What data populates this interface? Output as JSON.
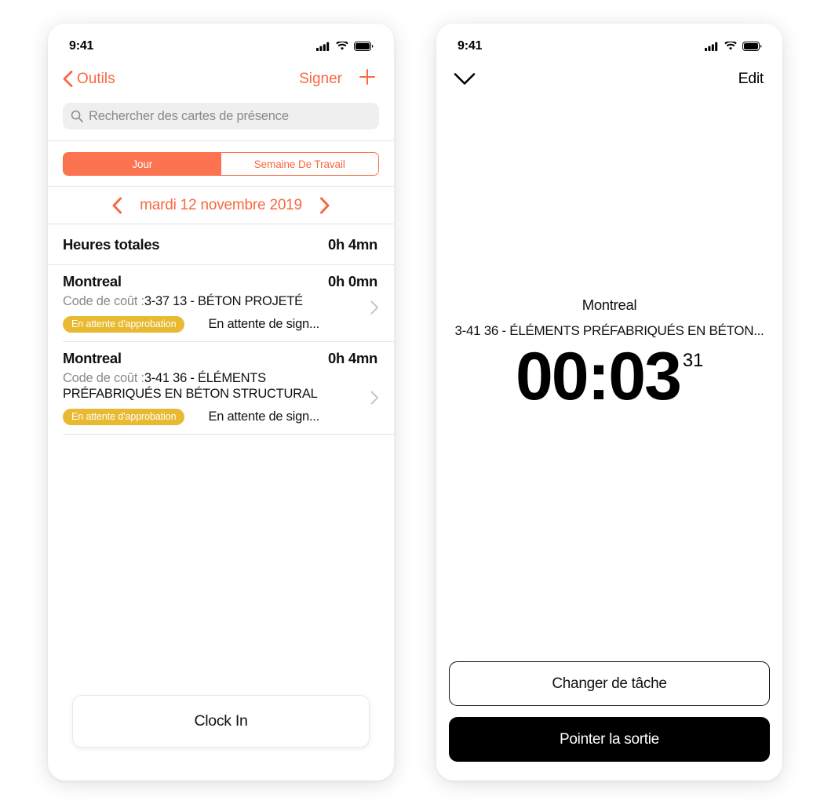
{
  "colors": {
    "accent_orange": "#FB7350",
    "accent_orange_text": "#F9683F",
    "badge_amber": "#E8B931",
    "primary_black": "#000000",
    "search_background": "#EFEFF0",
    "muted_text": "#8A8A8E",
    "hairline": "#E4E4E6"
  },
  "left_phone": {
    "status_bar": {
      "time": "9:41",
      "icons": [
        "cellular-signal-icon",
        "wifi-icon",
        "battery-icon"
      ]
    },
    "navbar": {
      "back_icon": "chevron-left-icon",
      "back_label": "Outils",
      "sign_label": "Signer",
      "add_icon": "plus-icon"
    },
    "search": {
      "icon": "search-icon",
      "placeholder": "Rechercher des cartes de présence",
      "value": ""
    },
    "segmented": {
      "options": [
        "Jour",
        "Semaine De Travail"
      ],
      "selected": "Jour"
    },
    "date_nav": {
      "prev_icon": "chevron-left-icon",
      "label": "mardi 12 novembre 2019",
      "next_icon": "chevron-right-icon"
    },
    "total": {
      "label": "Heures totales",
      "value": "0h 4mn"
    },
    "entries": [
      {
        "name": "Montreal",
        "hours": "0h 0mn",
        "code_label": "Code de coût :",
        "code_value": "3-37 13 - BÉTON PROJETÉ",
        "badge": "En attente d'approbation",
        "status": "En attente de sign...",
        "chevron_icon": "chevron-right-icon"
      },
      {
        "name": "Montreal",
        "hours": "0h 4mn",
        "code_label": "Code de coût :",
        "code_value": "3-41 36 - ÉLÉMENTS PRÉFABRIQUÉS EN BÉTON STRUCTURAL",
        "badge": "En attente d'approbation",
        "status": "En attente de sign...",
        "chevron_icon": "chevron-right-icon"
      }
    ],
    "clock_in_label": "Clock In"
  },
  "right_phone": {
    "status_bar": {
      "time": "9:41",
      "icons": [
        "cellular-signal-icon",
        "wifi-icon",
        "battery-icon"
      ]
    },
    "navbar": {
      "collapse_icon": "chevron-down-icon",
      "edit_label": "Edit"
    },
    "timer": {
      "project": "Montreal",
      "code": "3-41 36 - ÉLÉMENTS PRÉFABRIQUÉS EN BÉTON...",
      "elapsed": "00:03",
      "seconds": "31"
    },
    "buttons": {
      "switch_task_label": "Changer de tâche",
      "clock_out_label": "Pointer la sortie"
    }
  }
}
